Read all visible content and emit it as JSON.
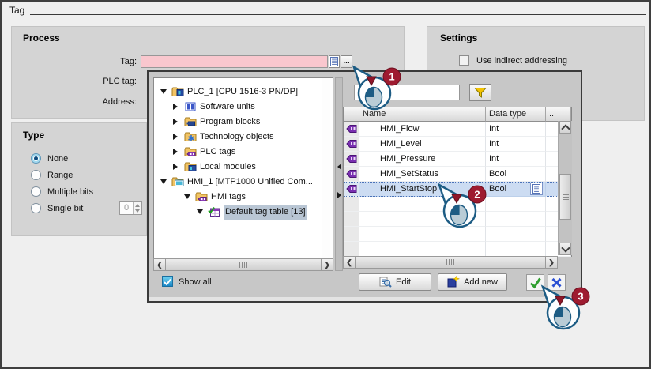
{
  "window": {
    "title": "Tag"
  },
  "process": {
    "title": "Process",
    "tag_label": "Tag:",
    "plc_tag_label": "PLC tag:",
    "address_label": "Address:",
    "tag_value": "",
    "browse_label": "..."
  },
  "settings": {
    "title": "Settings",
    "use_indirect_label": "Use indirect addressing",
    "use_indirect_checked": false
  },
  "type_group": {
    "title": "Type",
    "options": [
      {
        "label": "None",
        "selected": true
      },
      {
        "label": "Range",
        "selected": false
      },
      {
        "label": "Multiple bits",
        "selected": false
      },
      {
        "label": "Single bit",
        "selected": false
      }
    ],
    "single_bit_value": "0"
  },
  "popup": {
    "tree": {
      "items": [
        {
          "label": "PLC_1 [CPU 1516-3 PN/DP]",
          "level": 0,
          "expanded": true,
          "icon": "plc-device"
        },
        {
          "label": "Software units",
          "level": 1,
          "expanded": false,
          "icon": "software-units"
        },
        {
          "label": "Program blocks",
          "level": 1,
          "expanded": false,
          "icon": "program-blocks"
        },
        {
          "label": "Technology objects",
          "level": 1,
          "expanded": false,
          "icon": "technology-objects"
        },
        {
          "label": "PLC tags",
          "level": 1,
          "expanded": false,
          "icon": "plc-tags-folder"
        },
        {
          "label": "Local modules",
          "level": 1,
          "expanded": false,
          "icon": "local-modules"
        },
        {
          "label": "HMI_1 [MTP1000 Unified Com...",
          "level": 0,
          "expanded": true,
          "icon": "hmi-device"
        },
        {
          "label": "HMI tags",
          "level": 1,
          "expanded": true,
          "icon": "hmi-tags-folder"
        },
        {
          "label": "Default tag table [13]",
          "level": 2,
          "expanded": true,
          "icon": "tag-table",
          "selected": true
        }
      ]
    },
    "search": {
      "value": "",
      "placeholder": ""
    },
    "table": {
      "columns": [
        "Name",
        "Data type",
        ".."
      ],
      "rows": [
        {
          "name": "HMI_Flow",
          "data_type": "Int",
          "selected": false
        },
        {
          "name": "HMI_Level",
          "data_type": "Int",
          "selected": false
        },
        {
          "name": "HMI_Pressure",
          "data_type": "Int",
          "selected": false
        },
        {
          "name": "HMI_SetStatus",
          "data_type": "Bool",
          "selected": false
        },
        {
          "name": "HMI_StartStop",
          "data_type": "Bool",
          "selected": true
        }
      ]
    },
    "footer": {
      "show_all_label": "Show all",
      "show_all_checked": true,
      "edit_label": "Edit",
      "add_new_label": "Add new"
    }
  },
  "callouts": [
    {
      "number": "1"
    },
    {
      "number": "2"
    },
    {
      "number": "3"
    }
  ],
  "colors": {
    "invalid_field_pink": "#f9c7ce",
    "row_selection_blue": "#ccdcf2",
    "tree_selection_grey": "#b9c6d4",
    "callout_red": "#9e1b30",
    "callout_outline_blue": "#1d5c84",
    "confirm_green": "#2f9e2f",
    "cancel_blue": "#2b50d4",
    "filter_yellow": "#f3c200"
  }
}
